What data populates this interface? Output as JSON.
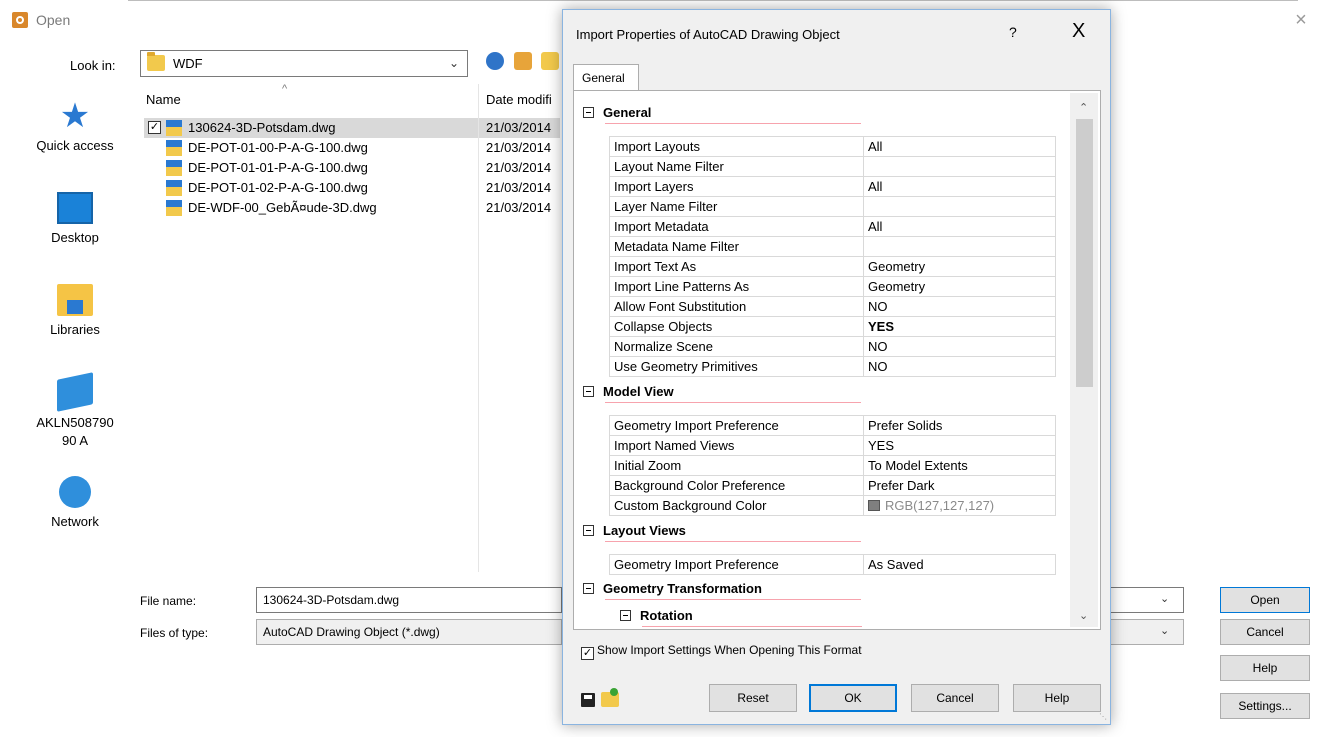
{
  "open_dialog": {
    "title": "Open",
    "close_glyph": "×",
    "look_in_label": "Look in:",
    "look_in_value": "WDF",
    "places": [
      {
        "label": "Quick access",
        "icon": "star-icon"
      },
      {
        "label": "Desktop",
        "icon": "desktop-icon"
      },
      {
        "label": "Libraries",
        "icon": "libraries-icon"
      },
      {
        "label": "AKLN50879090 A",
        "icon": "computer-icon"
      },
      {
        "label": "Network",
        "icon": "network-icon"
      }
    ],
    "columns": {
      "name": "Name",
      "date": "Date modifi"
    },
    "sort_glyph": "^",
    "files": [
      {
        "name": "130624-3D-Potsdam.dwg",
        "date": "21/03/2014",
        "selected": true
      },
      {
        "name": "DE-POT-01-00-P-A-G-100.dwg",
        "date": "21/03/2014",
        "selected": false
      },
      {
        "name": "DE-POT-01-01-P-A-G-100.dwg",
        "date": "21/03/2014",
        "selected": false
      },
      {
        "name": "DE-POT-01-02-P-A-G-100.dwg",
        "date": "21/03/2014",
        "selected": false
      },
      {
        "name": "DE-WDF-00_GebÃ¤ude-3D.dwg",
        "date": "21/03/2014",
        "selected": false
      }
    ],
    "file_name_label": "File name:",
    "file_name_value": "130624-3D-Potsdam.dwg",
    "files_of_type_label": "Files of type:",
    "files_of_type_value": "AutoCAD Drawing Object (*.dwg)",
    "buttons": {
      "open": "Open",
      "cancel": "Cancel",
      "help": "Help",
      "settings": "Settings..."
    }
  },
  "import_dialog": {
    "title": "Import Properties of AutoCAD Drawing Object",
    "help_glyph": "?",
    "close_glyph": "X",
    "tab": "General",
    "sections": {
      "general": {
        "title": "General",
        "rows": [
          {
            "key": "Import Layouts",
            "value": "All"
          },
          {
            "key": "Layout Name Filter",
            "value": ""
          },
          {
            "key": "Import Layers",
            "value": "All"
          },
          {
            "key": "Layer Name Filter",
            "value": ""
          },
          {
            "key": "Import Metadata",
            "value": "All"
          },
          {
            "key": "Metadata Name Filter",
            "value": ""
          },
          {
            "key": "Import Text As",
            "value": "Geometry"
          },
          {
            "key": "Import Line Patterns As",
            "value": "Geometry"
          },
          {
            "key": "Allow Font Substitution",
            "value": "NO"
          },
          {
            "key": "Collapse Objects",
            "value": "YES"
          },
          {
            "key": "Normalize Scene",
            "value": "NO"
          },
          {
            "key": "Use Geometry Primitives",
            "value": "NO"
          }
        ]
      },
      "model_view": {
        "title": "Model View",
        "rows": [
          {
            "key": "Geometry Import Preference",
            "value": "Prefer Solids"
          },
          {
            "key": "Import Named Views",
            "value": "YES"
          },
          {
            "key": "Initial Zoom",
            "value": "To Model Extents"
          },
          {
            "key": "Background Color Preference",
            "value": "Prefer Dark"
          },
          {
            "key": "Custom Background Color",
            "value": "RGB(127,127,127)"
          }
        ]
      },
      "layout_views": {
        "title": "Layout Views",
        "rows": [
          {
            "key": "Geometry Import Preference",
            "value": "As Saved"
          }
        ]
      },
      "geometry_transformation": {
        "title": "Geometry Transformation"
      },
      "rotation": {
        "title": "Rotation"
      }
    },
    "custom_color_hex": "#7f7f7f",
    "show_settings_label": "Show Import Settings When Opening This Format",
    "buttons": {
      "reset": "Reset",
      "ok": "OK",
      "cancel": "Cancel",
      "help": "Help"
    }
  },
  "colors": {
    "accent": "#0078d7",
    "section_underline": "#f7a3ad",
    "selection": "#d9d9d9"
  }
}
